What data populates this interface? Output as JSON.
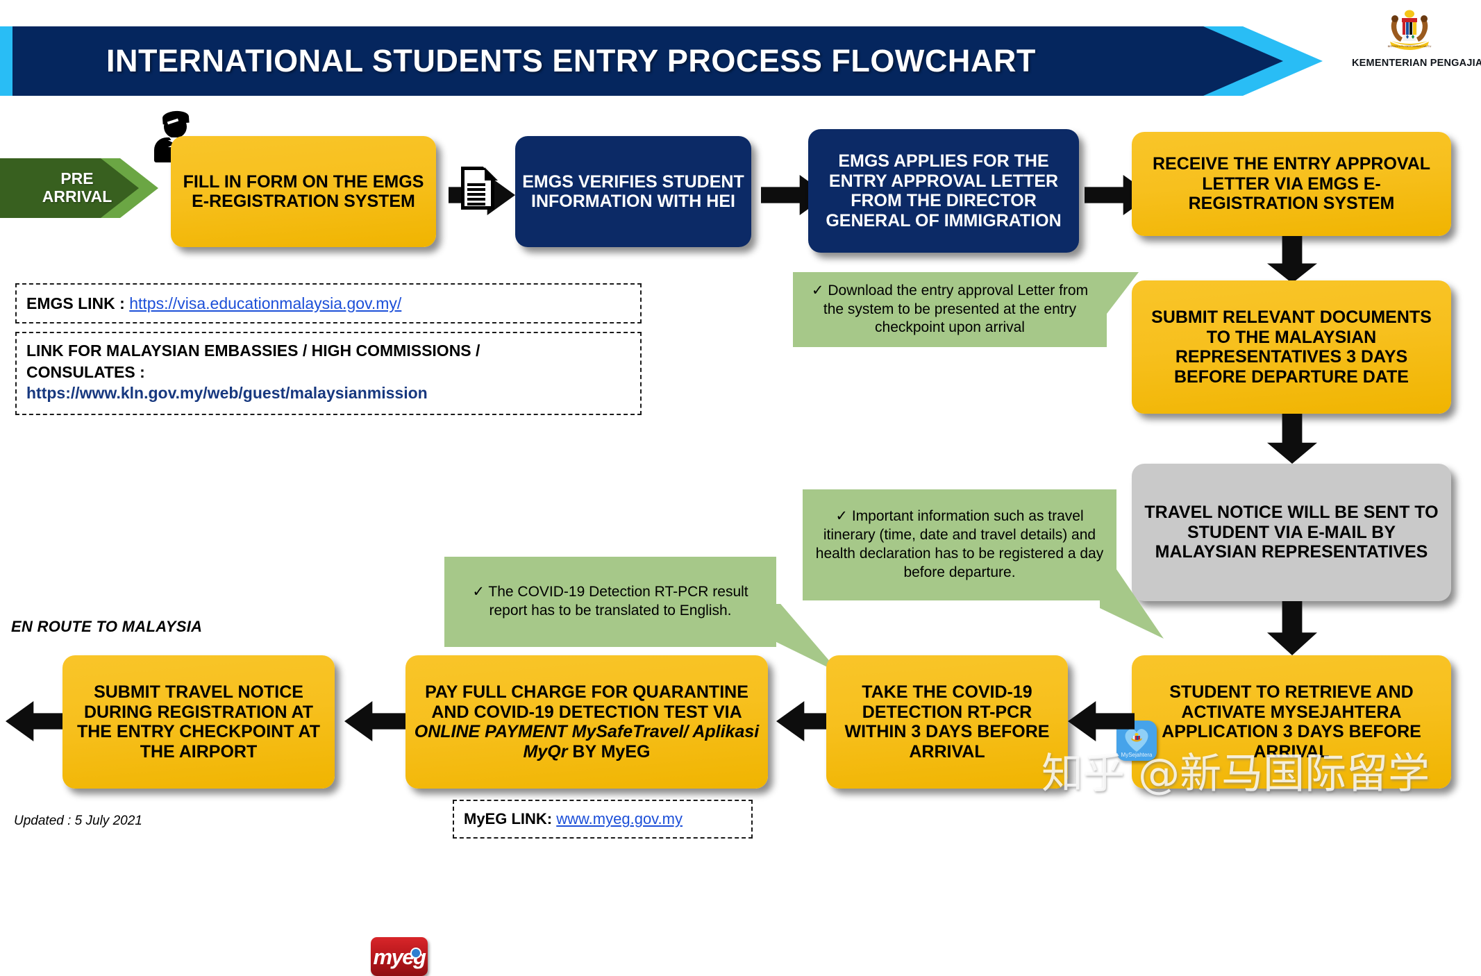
{
  "header": {
    "title": "INTERNATIONAL STUDENTS ENTRY PROCESS FLOWCHART",
    "ministry_label": "KEMENTERIAN PENGAJIAN TINGGI",
    "crest_icon": "malaysia-coat-of-arms-icon",
    "navy_color": "#05265e",
    "cyan_color": "#29bdf5"
  },
  "stage_label": {
    "pre_arrival": "PRE\nARRIVAL",
    "pre_arrival_line1": "PRE",
    "pre_arrival_line2": "ARRIVAL",
    "en_route": "EN ROUTE TO MALAYSIA"
  },
  "icons": {
    "student": "student-person-icon",
    "document": "document-form-icon",
    "mysejahtera": "mysejahtera-app-icon",
    "mysejahtera_label": "MySejahtera",
    "myeg": "myeg-logo-icon",
    "myeg_text": "myeg"
  },
  "boxes": {
    "fill_form": "FILL IN FORM ON THE EMGS E-REGISTRATION SYSTEM",
    "emgs_verifies": "EMGS VERIFIES STUDENT INFORMATION WITH HEI",
    "emgs_applies": "EMGS APPLIES FOR THE ENTRY APPROVAL LETTER FROM THE DIRECTOR GENERAL OF IMMIGRATION",
    "receive_letter": "RECEIVE THE ENTRY APPROVAL LETTER VIA EMGS E-REGISTRATION SYSTEM",
    "submit_documents": "SUBMIT RELEVANT DOCUMENTS TO THE MALAYSIAN REPRESENTATIVES  3 DAYS BEFORE DEPARTURE DATE",
    "travel_notice": "TRAVEL NOTICE WILL BE SENT TO STUDENT VIA E-MAIL BY MALAYSIAN REPRESENTATIVES",
    "retrieve_mysejahtera": "STUDENT TO RETRIEVE AND ACTIVATE MYSEJAHTERA APPLICATION 3 DAYS BEFORE ARRIVAL",
    "take_test": "TAKE THE COVID-19 DETECTION RT-PCR WITHIN 3 DAYS BEFORE ARRIVAL",
    "pay_charge_part1": "PAY FULL CHARGE FOR QUARANTINE AND COVID-19 DETECTION TEST VIA ",
    "pay_charge_italic": "ONLINE PAYMENT MySafeTravel/ Aplikasi MyQr",
    "pay_charge_part2": " BY MyEG",
    "submit_travel_notice": "SUBMIT TRAVEL NOTICE DURING REGISTRATION AT THE ENTRY CHECKPOINT AT THE AIRPORT"
  },
  "callouts": {
    "check_mark": "✓",
    "download_letter": "Download the entry approval Letter from the system to be presented at the entry checkpoint upon arrival",
    "important_info": "Important information such as travel itinerary (time, date and travel details) and health declaration has to be registered a day before departure.",
    "translate_report": "The COVID-19 Detection RT-PCR result report has to be translated to English."
  },
  "links": {
    "emgs_label": "EMGS LINK : ",
    "emgs_url": "https://visa.educationmalaysia.gov.my/",
    "embassy_label_line1": "LINK FOR MALAYSIAN EMBASSIES / HIGH COMMISSIONS /",
    "embassy_label_line2": "CONSULATES :",
    "embassy_url": "https://www.kln.gov.my/web/guest/malaysianmission",
    "myeg_label": "MyEG LINK: ",
    "myeg_url": "www.myeg.gov.my"
  },
  "footer": {
    "updated": "Updated :  5 July 2021",
    "watermark": "知乎 @新马国际留学"
  },
  "colors": {
    "yellow": "#f9c323",
    "navy_box": "#0c2a66",
    "gray_box": "#c9c9c9",
    "callout_green": "#a6c889",
    "chevron_dark_green": "#38601f",
    "chevron_light_green": "#6ba644",
    "link_blue": "#1c4fd8"
  }
}
